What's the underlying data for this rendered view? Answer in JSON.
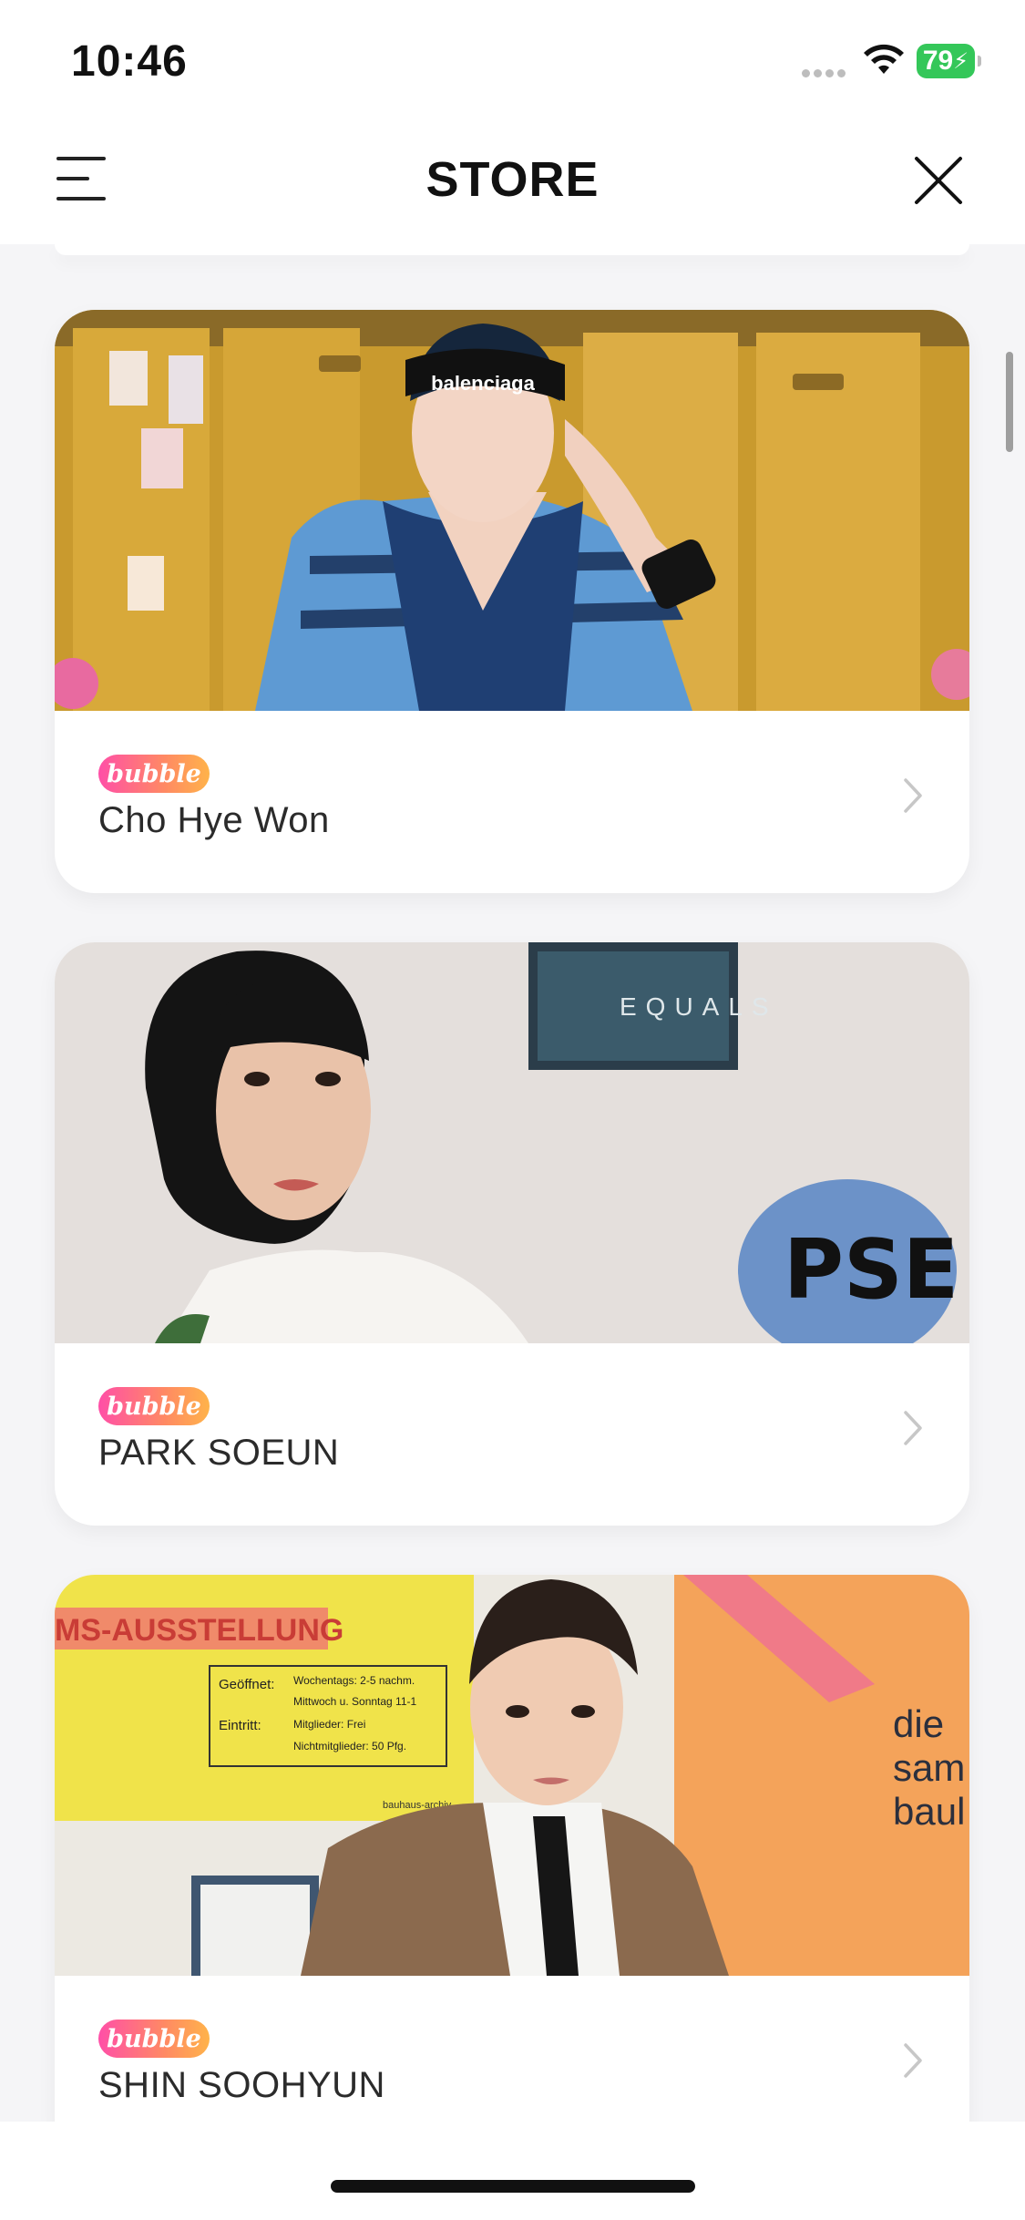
{
  "status_bar": {
    "time": "10:46",
    "battery": "79",
    "battery_color": "#34c759"
  },
  "header": {
    "title": "STORE",
    "menu_icon": "hamburger-menu-icon",
    "close_icon": "close-icon"
  },
  "badge_label": "bubble",
  "cards": [
    {
      "name": "Cho Hye Won",
      "image_hint": "photo-yellow-lockers"
    },
    {
      "name": "PARK SOEUN",
      "image_hint": "photo-white-wall-equals-poster"
    },
    {
      "name": "SHIN SOOHYUN",
      "image_hint": "photo-bauhaus-posters"
    }
  ],
  "poster_text": {
    "card2_poster": "EQUALS",
    "card3_headline": "MS-AUSSTELLUNG",
    "card3_rows": [
      [
        "Geöffnet:",
        "Wochentags: 2-5 nachm."
      ],
      [
        "",
        "Mittwoch u. Sonntag 11-1"
      ],
      [
        "Eintritt:",
        "Mitglieder: Frei"
      ],
      [
        "",
        "Nichtmitglieder: 50 Pfg."
      ]
    ],
    "card3_footer": "bauhaus-archiv",
    "card3_right": [
      "die",
      "sam",
      "baul"
    ]
  },
  "colors": {
    "badge_gradient_start": "#ff4fa7",
    "badge_gradient_end": "#ffb34a",
    "background": "#f5f5f7"
  }
}
